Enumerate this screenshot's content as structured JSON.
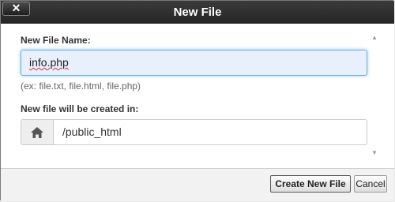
{
  "dialog": {
    "title": "New File",
    "close_glyph": "✕",
    "colors": {
      "titlebar": "#2f2f2f",
      "focus_border": "#66afe9",
      "autofill_bg": "#e8f0fe"
    }
  },
  "form": {
    "name_label": "New File Name:",
    "name_value": "info.php",
    "hint": "(ex: file.txt, file.html, file.php)",
    "location_label": "New file will be created in:",
    "location_value": "/public_html",
    "location_icon": "home-icon"
  },
  "buttons": {
    "create": "Create New File",
    "cancel": "Cancel"
  }
}
